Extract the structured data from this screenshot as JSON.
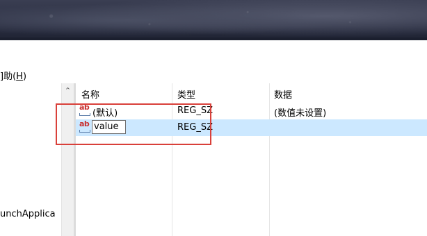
{
  "menu": {
    "help_prefix": "]助(",
    "help_key": "H",
    "help_suffix": ")"
  },
  "tree": {
    "visible_item": "unchApplica"
  },
  "list": {
    "columns": {
      "name": "名称",
      "type": "类型",
      "data": "数据"
    },
    "rows": [
      {
        "icon": "string-value-icon",
        "icon_text": "ab",
        "name": "(默认)",
        "type": "REG_SZ",
        "data": "(数值未设置)",
        "selected": false
      },
      {
        "icon": "string-value-icon",
        "icon_text": "ab",
        "name": "value",
        "type": "REG_SZ",
        "data": "",
        "selected": true,
        "editing": true
      }
    ]
  },
  "colors": {
    "selection": "#cce8ff",
    "annotation_border": "#d9403a"
  }
}
